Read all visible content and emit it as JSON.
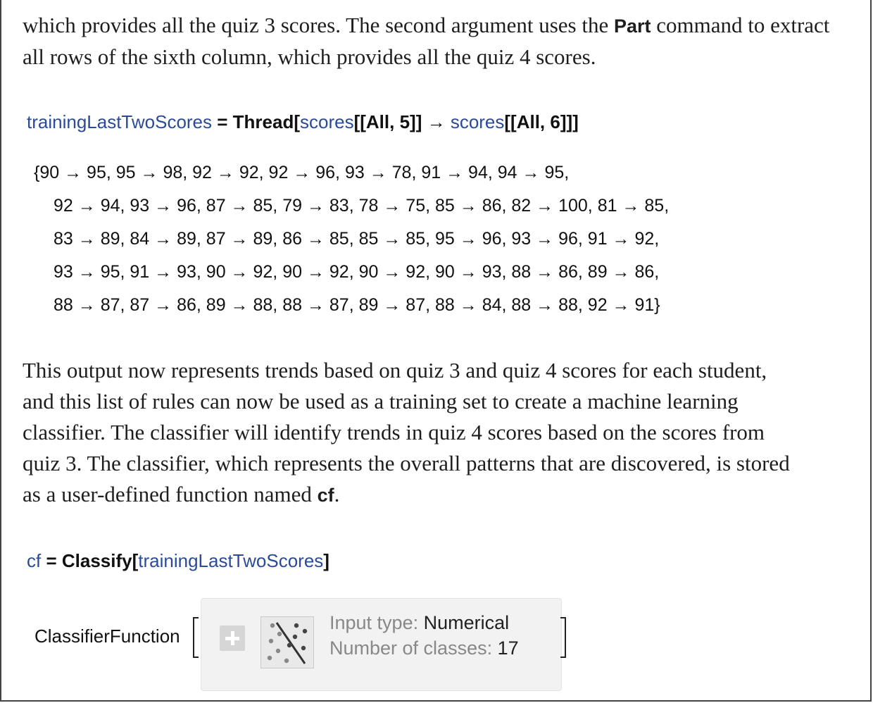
{
  "paragraph1": {
    "line1_pre": "which provides all the quiz 3 scores. The  second argument uses the ",
    "line1_bold": "Part",
    "line1_post": " command to extract",
    "line2": "all rows of the sixth column, which provides all the quiz 4 scores."
  },
  "input1": {
    "var": "trainingLastTwoScores",
    "eq": " = ",
    "func": "Thread[",
    "arg1": "scores",
    "part1": "[[All, 5]] → ",
    "arg2": "scores",
    "part2": "[[All, 6]]]"
  },
  "output1": {
    "lines": [
      "{90 → 95, 95 → 98, 92 → 92, 92 → 96, 93 → 78, 91 → 94, 94 → 95,",
      "92 → 94, 93 → 96, 87 → 85, 79 → 83, 78 → 75, 85 → 86, 82 → 100, 81 → 85,",
      "83 → 89, 84 → 89, 87 → 89, 86 → 85, 85 → 85, 95 → 96, 93 → 96, 91 → 92,",
      "93 → 95, 91 → 93, 90 → 92, 90 → 92, 90 → 92, 90 → 93, 88 → 86, 89 → 86,",
      "88 → 87, 87 → 86, 89 → 88, 88 → 87, 89 → 87, 88 → 84, 88 → 88, 92 → 91}"
    ]
  },
  "paragraph2": {
    "line1": "This  output now represents trends based on quiz 3 and quiz 4 scores for each student,",
    "line2": "and this list of rules can now be used as a training set to create a machine learning",
    "line3": "classifier. The  classifier will identify trends in quiz 4 scores based on the scores from",
    "line4": "quiz 3. The  classifier, which represents the overall patterns that are discovered, is stored",
    "line5_pre": "as a user-defined function named ",
    "line5_bold": "cf",
    "line5_post": "."
  },
  "input2": {
    "var": "cf",
    "eq": " = ",
    "func": "Classify[",
    "arg": "trainingLastTwoScores",
    "close": "]"
  },
  "classifier": {
    "head": "ClassifierFunction",
    "expand_icon": "plus-icon",
    "plot_icon": "classifier-scatter-icon",
    "input_type_label": "Input type: ",
    "input_type_value": "Numerical",
    "classes_label": "Number of classes: ",
    "classes_value": "17"
  }
}
